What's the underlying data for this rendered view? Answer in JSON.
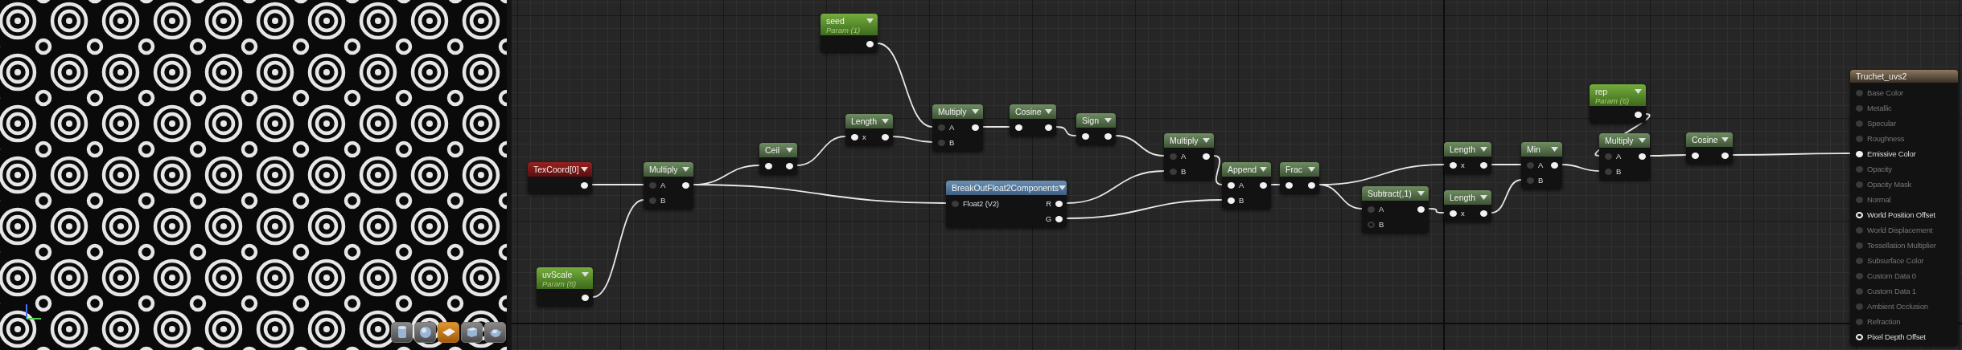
{
  "preview": {
    "toolbar": [
      {
        "kind": "cylinder",
        "selected": false
      },
      {
        "kind": "sphere",
        "selected": false
      },
      {
        "kind": "plane",
        "selected": true
      },
      {
        "kind": "cube",
        "selected": false
      },
      {
        "kind": "mesh",
        "selected": false
      }
    ]
  },
  "graph": {
    "nodes": [
      {
        "kind": "coord",
        "title": "TexCoord[0]",
        "outputs": [
          {
            "kind": "filled"
          }
        ]
      },
      {
        "kind": "param",
        "title": "uvScale",
        "subtitle": "Param (8)",
        "outputs": [
          {
            "kind": "filled"
          }
        ]
      },
      {
        "kind": "function",
        "title": "Multiply",
        "inputs": [
          {
            "label": "A",
            "kind": "dim"
          },
          {
            "label": "B",
            "kind": "dim"
          }
        ],
        "outputs": [
          {
            "kind": "filled"
          }
        ]
      },
      {
        "kind": "function",
        "title": "Ceil",
        "inputs": [
          {
            "kind": "filled"
          }
        ],
        "outputs": [
          {
            "kind": "filled"
          }
        ]
      },
      {
        "kind": "function",
        "title": "Length",
        "inputs": [
          {
            "label": "x",
            "kind": "filled"
          }
        ],
        "outputs": [
          {
            "kind": "filled"
          }
        ]
      },
      {
        "kind": "param",
        "title": "seed",
        "subtitle": "Param (1)",
        "outputs": [
          {
            "kind": "filled"
          }
        ]
      },
      {
        "kind": "function",
        "title": "Multiply",
        "inputs": [
          {
            "label": "A",
            "kind": "dim"
          },
          {
            "label": "B",
            "kind": "dim"
          }
        ],
        "outputs": [
          {
            "kind": "filled"
          }
        ]
      },
      {
        "kind": "function",
        "title": "Cosine",
        "inputs": [
          {
            "kind": "filled"
          }
        ],
        "outputs": [
          {
            "kind": "filled"
          }
        ]
      },
      {
        "kind": "breakout",
        "title": "BreakOutFloat2Components",
        "inputs": [
          {
            "label": "Float2 (V2)",
            "kind": "dim"
          }
        ],
        "outputs": [
          {
            "label": "R",
            "kind": "filled"
          },
          {
            "label": "G",
            "kind": "filled"
          }
        ]
      },
      {
        "kind": "function",
        "title": "Sign",
        "inputs": [
          {
            "kind": "filled"
          }
        ],
        "outputs": [
          {
            "kind": "filled"
          }
        ]
      },
      {
        "kind": "function",
        "title": "Multiply",
        "inputs": [
          {
            "label": "A",
            "kind": "dim"
          },
          {
            "label": "B",
            "kind": "dim"
          }
        ],
        "outputs": [
          {
            "kind": "filled"
          }
        ]
      },
      {
        "kind": "function",
        "title": "Append",
        "inputs": [
          {
            "label": "A",
            "kind": "filled"
          },
          {
            "label": "B",
            "kind": "filled"
          }
        ],
        "outputs": [
          {
            "kind": "filled"
          }
        ]
      },
      {
        "kind": "function",
        "title": "Frac",
        "inputs": [
          {
            "kind": "filled"
          }
        ],
        "outputs": [
          {
            "kind": "filled"
          }
        ]
      },
      {
        "kind": "function",
        "title": "Subtract(,1)",
        "inputs": [
          {
            "label": "A",
            "kind": "dim"
          },
          {
            "label": "B",
            "kind": "hollow-dim"
          }
        ],
        "outputs": [
          {
            "kind": "filled"
          }
        ]
      },
      {
        "kind": "function",
        "title": "Length",
        "inputs": [
          {
            "label": "x",
            "kind": "filled"
          }
        ],
        "outputs": [
          {
            "kind": "filled"
          }
        ]
      },
      {
        "kind": "function",
        "title": "Length",
        "inputs": [
          {
            "label": "x",
            "kind": "filled"
          }
        ],
        "outputs": [
          {
            "kind": "filled"
          }
        ]
      },
      {
        "kind": "function",
        "title": "Min",
        "inputs": [
          {
            "label": "A",
            "kind": "dim"
          },
          {
            "label": "B",
            "kind": "dim"
          }
        ],
        "outputs": [
          {
            "kind": "filled"
          }
        ]
      },
      {
        "kind": "param",
        "title": "rep",
        "subtitle": "Param (6)",
        "outputs": [
          {
            "kind": "filled"
          }
        ]
      },
      {
        "kind": "function",
        "title": "Multiply",
        "inputs": [
          {
            "label": "A",
            "kind": "dim"
          },
          {
            "label": "B",
            "kind": "dim"
          }
        ],
        "outputs": [
          {
            "kind": "filled"
          }
        ]
      },
      {
        "kind": "function",
        "title": "Cosine",
        "inputs": [
          {
            "kind": "filled"
          }
        ],
        "outputs": [
          {
            "kind": "filled"
          }
        ]
      },
      {
        "kind": "result",
        "title": "Truchet_uvs2",
        "inputs": [
          {
            "label": "Base Color",
            "kind": "dim",
            "enabled": false
          },
          {
            "label": "Metallic",
            "kind": "dim",
            "enabled": false
          },
          {
            "label": "Specular",
            "kind": "dim",
            "enabled": false
          },
          {
            "label": "Roughness",
            "kind": "dim",
            "enabled": false
          },
          {
            "label": "Emissive Color",
            "kind": "filled",
            "enabled": true
          },
          {
            "label": "Opacity",
            "kind": "dim",
            "enabled": false
          },
          {
            "label": "Opacity Mask",
            "kind": "dim",
            "enabled": false
          },
          {
            "label": "Normal",
            "kind": "dim",
            "enabled": false
          },
          {
            "label": "World Position Offset",
            "kind": "hollow",
            "enabled": true
          },
          {
            "label": "World Displacement",
            "kind": "dim",
            "enabled": false
          },
          {
            "label": "Tessellation Multiplier",
            "kind": "dim",
            "enabled": false
          },
          {
            "label": "Subsurface Color",
            "kind": "dim",
            "enabled": false
          },
          {
            "label": "Custom Data 0",
            "kind": "dim",
            "enabled": false
          },
          {
            "label": "Custom Data 1",
            "kind": "dim",
            "enabled": false
          },
          {
            "label": "Ambient Occlusion",
            "kind": "dim",
            "enabled": false
          },
          {
            "label": "Refraction",
            "kind": "dim",
            "enabled": false
          },
          {
            "label": "Pixel Depth Offset",
            "kind": "hollow",
            "enabled": true
          }
        ]
      }
    ]
  }
}
